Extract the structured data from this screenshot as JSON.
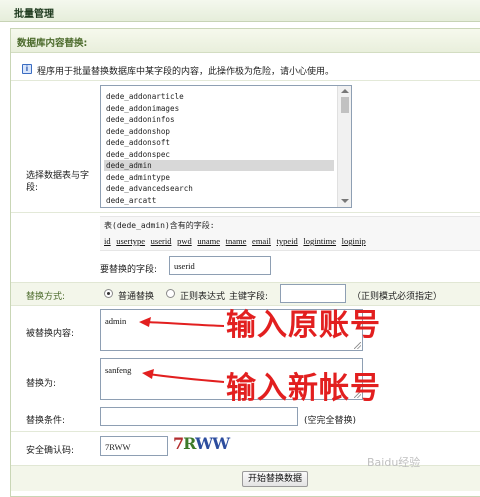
{
  "window": {
    "title": "批量管理"
  },
  "section": {
    "title": "数据库内容替换:"
  },
  "notice": "程序用于批量替换数据库中某字段的内容，此操作极为危险，请小心使用。",
  "table_select": {
    "label": "选择数据表与字段:",
    "options": [
      "dede_addonarticle",
      "dede_addonimages",
      "dede_addoninfos",
      "dede_addonshop",
      "dede_addonsoft",
      "dede_addonspec",
      "dede_admin",
      "dede_admintype",
      "dede_advancedsearch",
      "dede_arcatt"
    ],
    "selected": "dede_admin"
  },
  "fields": {
    "title": "表(dede_admin)含有的字段:",
    "items": [
      "id",
      "usertype",
      "userid",
      "pwd",
      "uname",
      "tname",
      "email",
      "typeid",
      "logintime",
      "loginip"
    ]
  },
  "replace_field": {
    "label": "要替换的字段:",
    "value": "userid"
  },
  "mode": {
    "label": "替换方式:",
    "normal_label": "普通替换",
    "regex_label": "正则表达式",
    "pk_label": "主键字段:",
    "regex_note": "（正则模式必须指定）",
    "selected": "normal"
  },
  "replaced": {
    "label": "被替换内容:",
    "value": "admin"
  },
  "replace_with": {
    "label": "替换为:",
    "value": "sanfeng"
  },
  "condition": {
    "label": "替换条件:",
    "value": "",
    "note": "(空完全替换)"
  },
  "captcha": {
    "label": "安全确认码:",
    "value": "7RWW",
    "image_text": [
      "7",
      "R",
      "WW"
    ]
  },
  "submit": {
    "label": "开始替换数据"
  },
  "annotations": {
    "first": "输入原账号",
    "second": "输入新帐号",
    "color": "#e21f1f"
  },
  "watermark": "Baidu经验",
  "colors": {
    "accent": "#4b6a2b",
    "header_bg": "#e9efdc",
    "annotation": "#e21f1f"
  }
}
